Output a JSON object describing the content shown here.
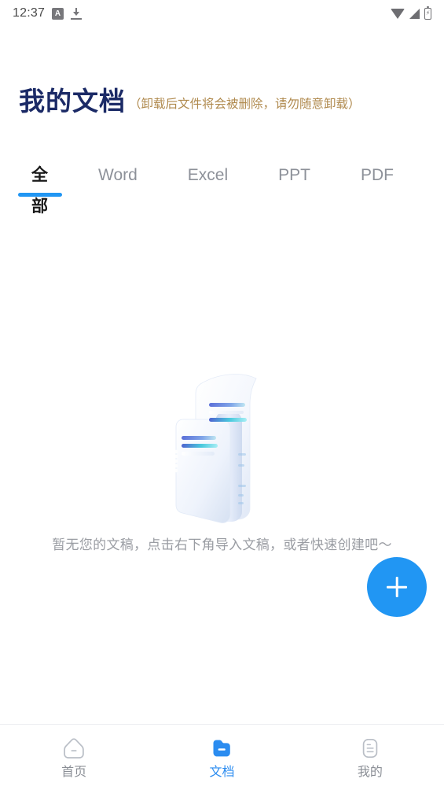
{
  "status_bar": {
    "time": "12:37",
    "badge_text": "A",
    "icons": [
      "notification-badge-icon",
      "download-icon",
      "wifi-icon",
      "signal-icon",
      "battery-charging-icon"
    ]
  },
  "header": {
    "title": "我的文档",
    "subtitle": "（卸载后文件将会被删除，请勿随意卸载）",
    "title_color": "#1b2a66",
    "subtitle_color": "#b08a4e"
  },
  "tabs": {
    "active_index": 0,
    "accent_color": "#2196f3",
    "items": [
      {
        "label": "全部"
      },
      {
        "label": "Word"
      },
      {
        "label": "Excel"
      },
      {
        "label": "PPT"
      },
      {
        "label": "PDF"
      }
    ]
  },
  "empty_state": {
    "message": "暂无您的文稿，点击右下角导入文稿，或者快速创建吧～",
    "illustration": "documents-illustration"
  },
  "fab": {
    "icon": "plus-icon",
    "color": "#2196f3"
  },
  "bottom_nav": {
    "active_index": 1,
    "active_color": "#2b8cf0",
    "inactive_color": "#8b8f96",
    "items": [
      {
        "label": "首页",
        "icon": "home-icon"
      },
      {
        "label": "文档",
        "icon": "folder-icon"
      },
      {
        "label": "我的",
        "icon": "profile-document-icon"
      }
    ]
  }
}
